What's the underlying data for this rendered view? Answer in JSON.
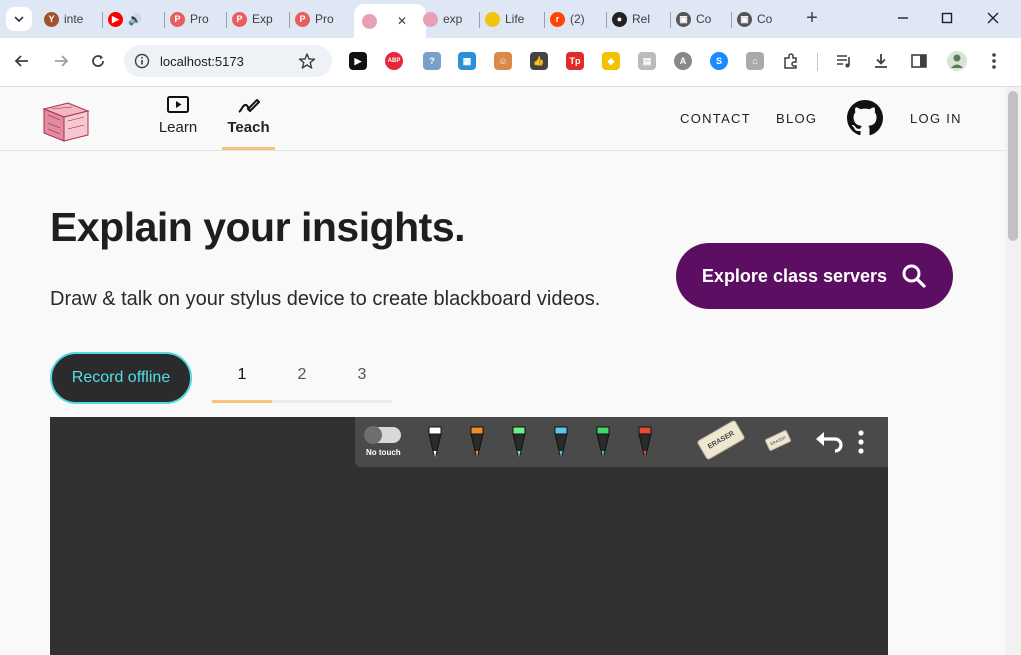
{
  "browser": {
    "tabs": [
      {
        "title": "inte",
        "favicon_color": "#a0522d",
        "favicon_glyph": "Y"
      },
      {
        "title": "",
        "favicon_color": "#ff0000",
        "favicon_glyph": "▶",
        "audio": true
      },
      {
        "title": "Pro",
        "favicon_color": "#e85d5d",
        "favicon_glyph": "P"
      },
      {
        "title": "Exp",
        "favicon_color": "#e85d5d",
        "favicon_glyph": "P"
      },
      {
        "title": "Pro",
        "favicon_color": "#e85d5d",
        "favicon_glyph": "P"
      },
      {
        "title": "",
        "favicon_color": "#e7a0b8",
        "favicon_glyph": "",
        "active": true
      },
      {
        "title": "exp",
        "favicon_color": "#e7a0b8",
        "favicon_glyph": ""
      },
      {
        "title": "Life",
        "favicon_color": "#f4c20d",
        "favicon_glyph": ""
      },
      {
        "title": "(2)",
        "favicon_color": "#ff4500",
        "favicon_glyph": "r"
      },
      {
        "title": "Rel",
        "favicon_color": "#222222",
        "favicon_glyph": "●"
      },
      {
        "title": "Co",
        "favicon_color": "#555555",
        "favicon_glyph": "▣"
      },
      {
        "title": "Co",
        "favicon_color": "#555555",
        "favicon_glyph": "▣"
      }
    ],
    "url": "localhost:5173",
    "extensions": [
      {
        "name": "play-extension-icon",
        "color": "#111111",
        "glyph": "▶"
      },
      {
        "name": "abp-extension-icon",
        "color": "#e8263a",
        "glyph": "ABP"
      },
      {
        "name": "chat-extension-icon",
        "color": "#7aa0c8",
        "glyph": "?"
      },
      {
        "name": "window-extension-icon",
        "color": "#2b90d9",
        "glyph": "▦"
      },
      {
        "name": "face-extension-icon",
        "color": "#d98a4a",
        "glyph": "☺"
      },
      {
        "name": "thumbs-up-extension-icon",
        "color": "#444444",
        "glyph": "👍"
      },
      {
        "name": "tp-extension-icon",
        "color": "#e02b2b",
        "glyph": "Tp"
      },
      {
        "name": "diamond-extension-icon",
        "color": "#f2c200",
        "glyph": "◆"
      },
      {
        "name": "print-extension-icon",
        "color": "#bbbbbb",
        "glyph": "▤"
      },
      {
        "name": "arc-extension-icon",
        "color": "#888888",
        "glyph": "A"
      },
      {
        "name": "shazam-extension-icon",
        "color": "#1a8cff",
        "glyph": "S"
      },
      {
        "name": "gray-extension-icon",
        "color": "#aaaaaa",
        "glyph": "⌂"
      }
    ]
  },
  "header": {
    "nav": [
      {
        "label": "Learn",
        "icon": "play-icon",
        "active": false
      },
      {
        "label": "Teach",
        "icon": "pen-icon",
        "active": true
      }
    ],
    "links": {
      "contact": "CONTACT",
      "blog": "BLOG",
      "login": "LOG IN"
    }
  },
  "hero": {
    "title": "Explain your insights.",
    "subtitle": "Draw & talk on your stylus device to create blackboard videos.",
    "explore_label": "Explore class servers"
  },
  "record_label": "Record offline",
  "steps": [
    "1",
    "2",
    "3"
  ],
  "active_step": "1",
  "board": {
    "no_touch_label": "No touch",
    "pens": [
      "#ffffff",
      "#f28c28",
      "#6cf08a",
      "#5cc8e8",
      "#3fd66a",
      "#e84a3a"
    ],
    "eraser_label": "ERASER",
    "small_eraser_label": "ERASER"
  },
  "colors": {
    "accent_purple": "#5c0e63",
    "accent_teal": "#4fd9e0",
    "tab_underline": "#f5c27a"
  }
}
